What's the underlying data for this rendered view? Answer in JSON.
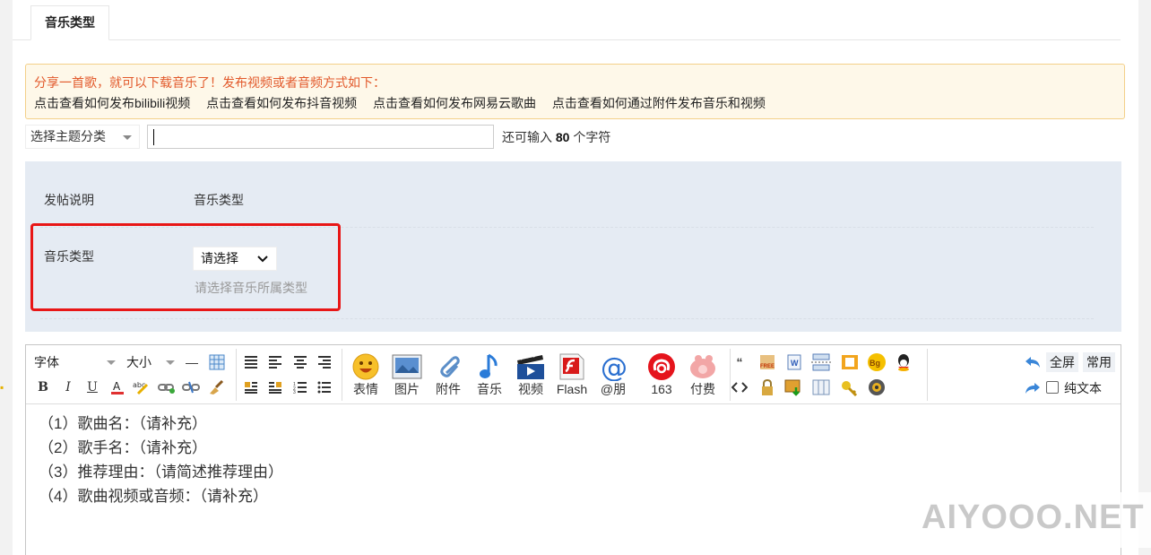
{
  "tab": {
    "label": "音乐类型"
  },
  "notice": {
    "title": "分享一首歌，就可以下载音乐了！发布视频或者音频方式如下：",
    "links": [
      "点击查看如何发布bilibili视频",
      "点击查看如何发布抖音视频",
      "点击查看如何发布网易云歌曲",
      "点击查看如何通过附件发布音乐和视频"
    ]
  },
  "subject": {
    "category_placeholder": "选择主题分类",
    "title_value": "",
    "counter_prefix": "还可输入",
    "counter_number": "80",
    "counter_suffix": "个字符"
  },
  "panel": {
    "row1_label": "发帖说明",
    "row1_value": "音乐类型",
    "row2_label": "音乐类型",
    "select_value": "请选择",
    "hint": "请选择音乐所属类型"
  },
  "toolbar": {
    "font_label": "字体",
    "size_label": "大小",
    "hr_label": "—",
    "big_buttons": [
      "表情",
      "图片",
      "附件",
      "音乐",
      "视频",
      "Flash",
      "@朋",
      "163",
      "付费"
    ],
    "fullscreen": "全屏",
    "common": "常用",
    "plain_text": "纯文本"
  },
  "editor": {
    "lines": [
      "（1）歌曲名：（请补充）",
      "（2）歌手名：（请补充）",
      "（3）推荐理由：（请简述推荐理由）",
      "（4）歌曲视频或音频：（请补充）"
    ]
  },
  "watermark": "AIYOOO.NET",
  "colors": {
    "notice_title": "#e2592b",
    "notice_bg": "#fef8e9",
    "panel_bg": "#e5ebf3",
    "highlight_box": "#e81616"
  }
}
